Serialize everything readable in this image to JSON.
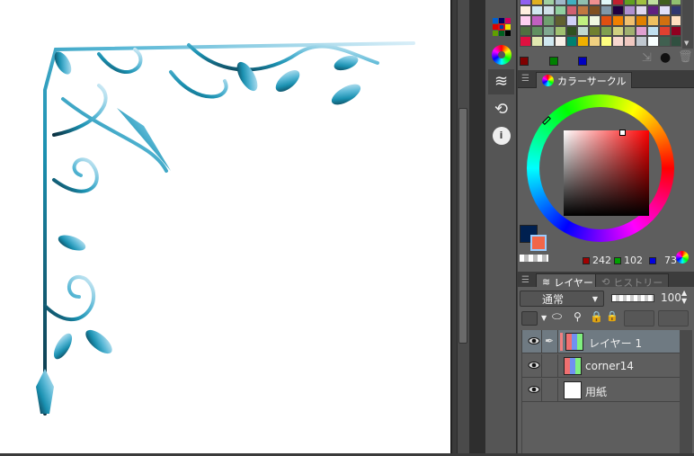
{
  "palette": {
    "swatches": [
      "#9060f0",
      "#e0b020",
      "#a0d0a0",
      "#a0b8c8",
      "#40b0c0",
      "#90c0b0",
      "#f09090",
      "#e0f8f8",
      "#c02030",
      "#60a020",
      "#a0c040",
      "#c0e0a0",
      "#406020",
      "#90c070",
      "#fff0e0",
      "#d0e8f0",
      "#d0e0e8",
      "#90d0a0",
      "#d06070",
      "#c07840",
      "#805020",
      "#8098a8",
      "#200040",
      "#b090d0",
      "#e0d8f0",
      "#602080",
      "#e0e0f8",
      "#303870",
      "#ffd0f0",
      "#c060c0",
      "#70a070",
      "#606030",
      "#d0d0f8",
      "#c0f080",
      "#f0f8e0",
      "#e05010",
      "#f08000",
      "#f0c070",
      "#e08000",
      "#f0c060",
      "#d07010",
      "#ffe0c0",
      "#507040",
      "#609060",
      "#80a890",
      "#a0c070",
      "#305020",
      "#c0d8d0",
      "#708030",
      "#80a050",
      "#d0d080",
      "#a0b070",
      "#e0a0d0",
      "#c0e0f0",
      "#e04030",
      "#900020",
      "#e01040",
      "#e0e8b0",
      "#d0e8f0",
      "#f8f0e8",
      "#008070",
      "#f0b000",
      "#f0d080",
      "#ffff80",
      "#f8d8d0",
      "#f0c8c0",
      "#c0c8d0",
      "#f8ffff",
      "#406050",
      "#305040"
    ],
    "chips": [
      "#800000",
      "#008000",
      "#0000c0"
    ]
  },
  "color_panel": {
    "tab_label": "カラーサークル",
    "r": "242",
    "g": "102",
    "b": "73",
    "main_color": "#f26649",
    "sub_color": "#002050"
  },
  "layer_panel": {
    "tab_layer": "レイヤー",
    "tab_history": "ヒストリー",
    "blend_mode": "通常",
    "opacity": "100",
    "layers": [
      {
        "name": "レイヤー 1",
        "selected": true
      },
      {
        "name": "corner14",
        "selected": false
      },
      {
        "name": "用紙",
        "selected": false
      }
    ]
  }
}
